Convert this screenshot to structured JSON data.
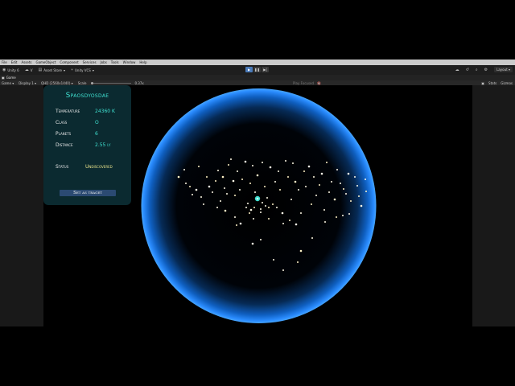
{
  "menu": [
    "File",
    "Edit",
    "Assets",
    "GameObject",
    "Component",
    "Services",
    "Jobs",
    "Tools",
    "Window",
    "Help"
  ],
  "toolbar": {
    "account": "Unity 6",
    "cloud": "V",
    "asset_store": "Asset Store",
    "vcs": "Unity VCS",
    "layout": "Layout"
  },
  "tab": {
    "label": "Game"
  },
  "gamebar": {
    "mode": "Game",
    "display": "Display 1",
    "resolution": "QHD (2560x1440)",
    "scale_label": "Scale",
    "scale_value": "0.37x",
    "play_focused": "Play Focused",
    "stats": "Stats",
    "gizmos": "Gizmos"
  },
  "star_info": {
    "name": "Spaosdyosdae",
    "temperature_label": "Temperature",
    "temperature_value": "24360 K",
    "class_label": "Class",
    "class_value": "O",
    "planets_label": "Planets",
    "planets_value": "6",
    "distance_label": "Distance",
    "distance_value": "2.55 ly",
    "status_label": "Status",
    "status_value": "Undiscovered",
    "button_label": "Set as traget"
  },
  "colors": {
    "accent": "#3fe0d0",
    "status": "#e8e28a",
    "sphere_glow": "#1e7fff"
  }
}
